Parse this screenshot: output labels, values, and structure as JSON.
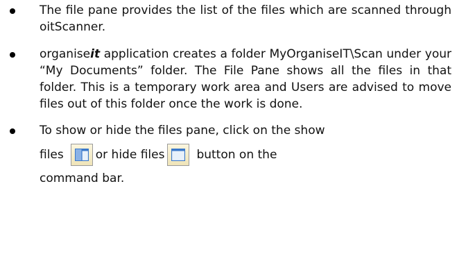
{
  "bullets": [
    {
      "text": "The file pane provides the list of the files which are scanned through oitScanner."
    },
    {
      "brand_prefix": "organise",
      "brand_suffix": "it",
      "text": " application creates a folder MyOrganiseIT\\Scan under your “My Documents” folder. The File Pane shows all the files in that folder. This is a temporary work area and Users are advised to move files out of this folder once the work is done."
    },
    {
      "line1": "To show or hide the files pane, click on the show",
      "show_label": "files",
      "hide_label": "or hide files",
      "after_label": "button on the",
      "line3": "command bar.",
      "show_icon": "show-files-icon",
      "hide_icon": "hide-files-icon"
    }
  ],
  "colors": {
    "icon_border": "#9a9a9a",
    "icon_fill_top": "#fbf6df",
    "icon_fill_bottom": "#efe4b8",
    "icon_glyph_blue": "#3a78c9",
    "icon_glyph_light": "#e8f1fb"
  }
}
